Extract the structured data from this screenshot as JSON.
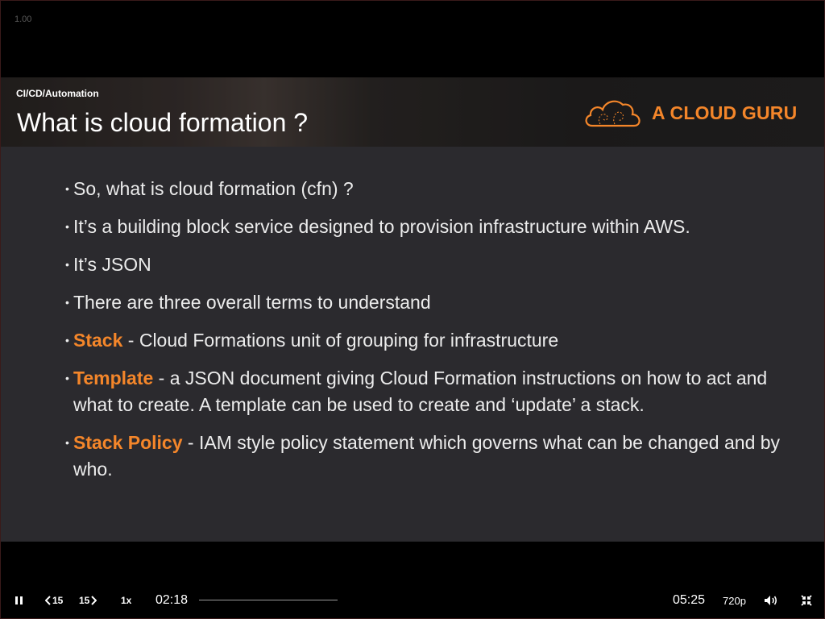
{
  "player": {
    "speed_readout": "1.00",
    "controls": {
      "skip_back_label": "15",
      "skip_forward_label": "15",
      "playback_speed": "1x",
      "current_time": "02:18",
      "total_time": "05:25",
      "quality": "720p",
      "progress_fraction": 0
    },
    "icons": {
      "pause": "pause-icon",
      "skip_back": "rewind-15-icon",
      "skip_forward": "forward-15-icon",
      "volume": "volume-icon",
      "exit_fullscreen": "exit-fullscreen-icon"
    }
  },
  "slide": {
    "breadcrumb": "CI/CD/Automation",
    "title": "What is cloud formation ?",
    "logo_text": "A CLOUD GURU",
    "accent_color": "#f4862a",
    "bullets": [
      {
        "term": "",
        "sep": "",
        "text": "So, what is cloud formation (cfn) ?"
      },
      {
        "term": "",
        "sep": "",
        "text": "It’s a building block service designed to provision infrastructure within AWS."
      },
      {
        "term": "",
        "sep": "",
        "text": "It’s JSON"
      },
      {
        "term": "",
        "sep": "",
        "text": "There are three overall terms to understand"
      },
      {
        "term": "Stack",
        "sep": " - ",
        "text": "Cloud Formations unit of grouping for infrastructure"
      },
      {
        "term": "Template",
        "sep": " - ",
        "text": "a JSON document giving Cloud Formation instructions on how to act and what to create. A template can be used to create and ‘update’ a stack."
      },
      {
        "term": "Stack Policy",
        "sep": " - ",
        "text": "IAM style policy statement which governs what can be changed and by who."
      }
    ]
  }
}
